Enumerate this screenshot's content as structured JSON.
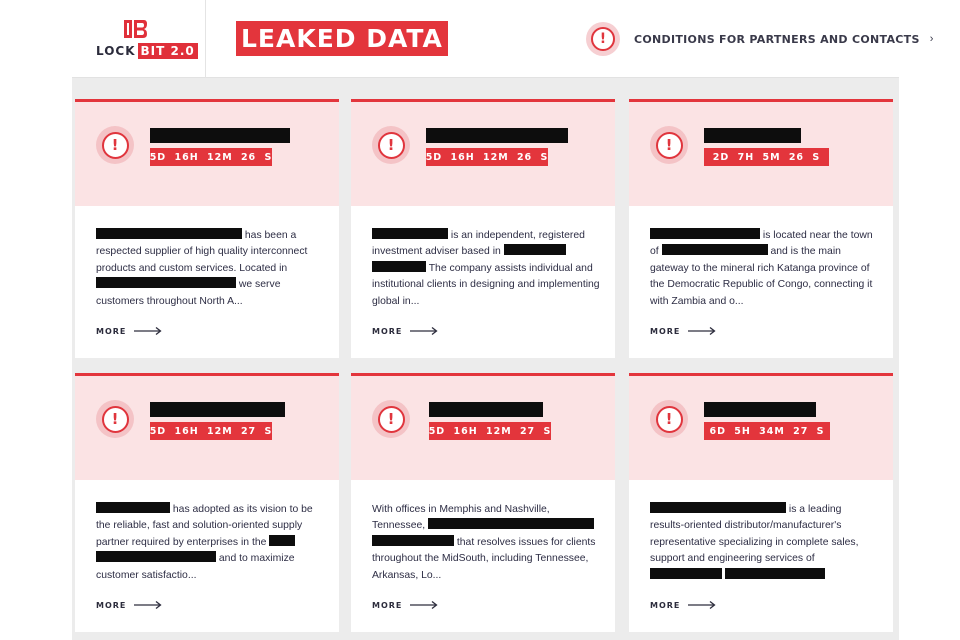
{
  "header": {
    "logo_left": "LOCK",
    "logo_bit": "BIT",
    "logo_version": "2.0",
    "title": "LEAKED DATA",
    "conditions_link": "CONDITIONS FOR PARTNERS AND CONTACTS",
    "conditions_chevron": "›"
  },
  "colors": {
    "accent": "#e3353c",
    "card_top": "#fbe3e4",
    "redaction": "#0d0d0d"
  },
  "cards": [
    {
      "timer": "5D  16H  12M  26 S",
      "desc": {
        "p1": "has been a respected supplier of high quality interconnect products and custom services. Located in",
        "p2": "we serve customers throughout North A..."
      },
      "more": "MORE"
    },
    {
      "timer": "5D  16H  12M  26 S",
      "desc": {
        "p1": "is an independent, registered investment adviser based in",
        "p2": "The company assists individual and institutional clients in designing and implementing global in..."
      },
      "more": "MORE"
    },
    {
      "timer": "2D  7H  5M  26 S",
      "desc": {
        "p1": "is located near the town of",
        "p2": "and is the main gateway to the mineral rich Katanga province of the Democratic Republic of Congo, connecting it with Zambia and o..."
      },
      "more": "MORE"
    },
    {
      "timer": "5D  16H  12M  27 S",
      "desc": {
        "p1": "has adopted as its vision to be the reliable, fast and solution-oriented supply partner required by enterprises in the",
        "p2": "and to maximize customer satisfactio..."
      },
      "more": "MORE"
    },
    {
      "timer": "5D  16H  12M  27 S",
      "desc": {
        "p1": "With offices in Memphis and Nashville, Tennessee,",
        "p2": "that resolves issues for clients throughout the MidSouth, including Tennessee, Arkansas, Lo..."
      },
      "more": "MORE"
    },
    {
      "timer": "6D  5H  34M  27 S",
      "desc": {
        "p1": "is a leading results-oriented distributor/manufacturer's representative specializing in complete sales, support and engineering services of",
        "p2": ""
      },
      "more": "MORE"
    }
  ]
}
